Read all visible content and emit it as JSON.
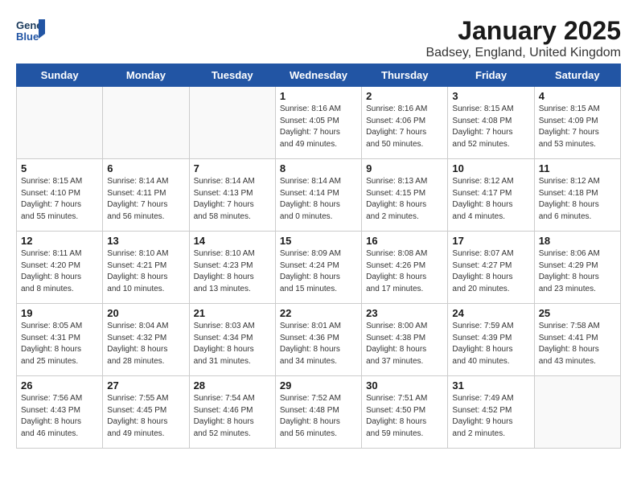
{
  "logo": {
    "line1": "General",
    "line2": "Blue"
  },
  "title": "January 2025",
  "subtitle": "Badsey, England, United Kingdom",
  "days_of_week": [
    "Sunday",
    "Monday",
    "Tuesday",
    "Wednesday",
    "Thursday",
    "Friday",
    "Saturday"
  ],
  "weeks": [
    [
      {
        "day": "",
        "info": ""
      },
      {
        "day": "",
        "info": ""
      },
      {
        "day": "",
        "info": ""
      },
      {
        "day": "1",
        "info": "Sunrise: 8:16 AM\nSunset: 4:05 PM\nDaylight: 7 hours\nand 49 minutes."
      },
      {
        "day": "2",
        "info": "Sunrise: 8:16 AM\nSunset: 4:06 PM\nDaylight: 7 hours\nand 50 minutes."
      },
      {
        "day": "3",
        "info": "Sunrise: 8:15 AM\nSunset: 4:08 PM\nDaylight: 7 hours\nand 52 minutes."
      },
      {
        "day": "4",
        "info": "Sunrise: 8:15 AM\nSunset: 4:09 PM\nDaylight: 7 hours\nand 53 minutes."
      }
    ],
    [
      {
        "day": "5",
        "info": "Sunrise: 8:15 AM\nSunset: 4:10 PM\nDaylight: 7 hours\nand 55 minutes."
      },
      {
        "day": "6",
        "info": "Sunrise: 8:14 AM\nSunset: 4:11 PM\nDaylight: 7 hours\nand 56 minutes."
      },
      {
        "day": "7",
        "info": "Sunrise: 8:14 AM\nSunset: 4:13 PM\nDaylight: 7 hours\nand 58 minutes."
      },
      {
        "day": "8",
        "info": "Sunrise: 8:14 AM\nSunset: 4:14 PM\nDaylight: 8 hours\nand 0 minutes."
      },
      {
        "day": "9",
        "info": "Sunrise: 8:13 AM\nSunset: 4:15 PM\nDaylight: 8 hours\nand 2 minutes."
      },
      {
        "day": "10",
        "info": "Sunrise: 8:12 AM\nSunset: 4:17 PM\nDaylight: 8 hours\nand 4 minutes."
      },
      {
        "day": "11",
        "info": "Sunrise: 8:12 AM\nSunset: 4:18 PM\nDaylight: 8 hours\nand 6 minutes."
      }
    ],
    [
      {
        "day": "12",
        "info": "Sunrise: 8:11 AM\nSunset: 4:20 PM\nDaylight: 8 hours\nand 8 minutes."
      },
      {
        "day": "13",
        "info": "Sunrise: 8:10 AM\nSunset: 4:21 PM\nDaylight: 8 hours\nand 10 minutes."
      },
      {
        "day": "14",
        "info": "Sunrise: 8:10 AM\nSunset: 4:23 PM\nDaylight: 8 hours\nand 13 minutes."
      },
      {
        "day": "15",
        "info": "Sunrise: 8:09 AM\nSunset: 4:24 PM\nDaylight: 8 hours\nand 15 minutes."
      },
      {
        "day": "16",
        "info": "Sunrise: 8:08 AM\nSunset: 4:26 PM\nDaylight: 8 hours\nand 17 minutes."
      },
      {
        "day": "17",
        "info": "Sunrise: 8:07 AM\nSunset: 4:27 PM\nDaylight: 8 hours\nand 20 minutes."
      },
      {
        "day": "18",
        "info": "Sunrise: 8:06 AM\nSunset: 4:29 PM\nDaylight: 8 hours\nand 23 minutes."
      }
    ],
    [
      {
        "day": "19",
        "info": "Sunrise: 8:05 AM\nSunset: 4:31 PM\nDaylight: 8 hours\nand 25 minutes."
      },
      {
        "day": "20",
        "info": "Sunrise: 8:04 AM\nSunset: 4:32 PM\nDaylight: 8 hours\nand 28 minutes."
      },
      {
        "day": "21",
        "info": "Sunrise: 8:03 AM\nSunset: 4:34 PM\nDaylight: 8 hours\nand 31 minutes."
      },
      {
        "day": "22",
        "info": "Sunrise: 8:01 AM\nSunset: 4:36 PM\nDaylight: 8 hours\nand 34 minutes."
      },
      {
        "day": "23",
        "info": "Sunrise: 8:00 AM\nSunset: 4:38 PM\nDaylight: 8 hours\nand 37 minutes."
      },
      {
        "day": "24",
        "info": "Sunrise: 7:59 AM\nSunset: 4:39 PM\nDaylight: 8 hours\nand 40 minutes."
      },
      {
        "day": "25",
        "info": "Sunrise: 7:58 AM\nSunset: 4:41 PM\nDaylight: 8 hours\nand 43 minutes."
      }
    ],
    [
      {
        "day": "26",
        "info": "Sunrise: 7:56 AM\nSunset: 4:43 PM\nDaylight: 8 hours\nand 46 minutes."
      },
      {
        "day": "27",
        "info": "Sunrise: 7:55 AM\nSunset: 4:45 PM\nDaylight: 8 hours\nand 49 minutes."
      },
      {
        "day": "28",
        "info": "Sunrise: 7:54 AM\nSunset: 4:46 PM\nDaylight: 8 hours\nand 52 minutes."
      },
      {
        "day": "29",
        "info": "Sunrise: 7:52 AM\nSunset: 4:48 PM\nDaylight: 8 hours\nand 56 minutes."
      },
      {
        "day": "30",
        "info": "Sunrise: 7:51 AM\nSunset: 4:50 PM\nDaylight: 8 hours\nand 59 minutes."
      },
      {
        "day": "31",
        "info": "Sunrise: 7:49 AM\nSunset: 4:52 PM\nDaylight: 9 hours\nand 2 minutes."
      },
      {
        "day": "",
        "info": ""
      }
    ]
  ]
}
